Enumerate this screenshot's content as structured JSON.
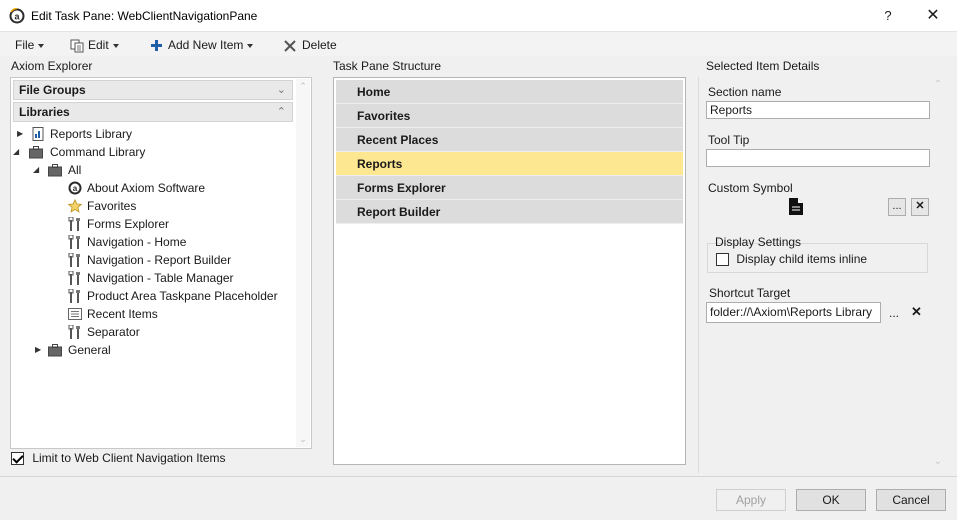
{
  "window": {
    "title": "Edit Task Pane: WebClientNavigationPane",
    "help_label": "?",
    "close_label": "✕"
  },
  "menu": {
    "file": "File",
    "edit": "Edit",
    "add_new_item": "Add New Item",
    "delete": "Delete"
  },
  "explorer": {
    "heading": "Axiom Explorer",
    "file_groups": "File Groups",
    "libraries": "Libraries",
    "tree": {
      "reports_library": "Reports Library",
      "command_library": "Command Library",
      "all": "All",
      "items": [
        {
          "label": "About Axiom Software",
          "icon": "axiom-logo-icon"
        },
        {
          "label": "Favorites",
          "icon": "star-icon"
        },
        {
          "label": "Forms Explorer",
          "icon": "tools-icon"
        },
        {
          "label": "Navigation - Home",
          "icon": "tools-icon"
        },
        {
          "label": "Navigation - Report Builder",
          "icon": "tools-icon"
        },
        {
          "label": "Navigation - Table Manager",
          "icon": "tools-icon"
        },
        {
          "label": "Product Area Taskpane Placeholder",
          "icon": "tools-icon"
        },
        {
          "label": "Recent Items",
          "icon": "recent-list-icon"
        },
        {
          "label": "Separator",
          "icon": "tools-icon"
        }
      ],
      "general": "General"
    },
    "limit_label": "Limit to Web Client Navigation Items",
    "limit_checked": true
  },
  "structure": {
    "heading": "Task Pane Structure",
    "items": [
      "Home",
      "Favorites",
      "Recent Places",
      "Reports",
      "Forms Explorer",
      "Report Builder"
    ],
    "selected": "Reports"
  },
  "details": {
    "heading": "Selected Item Details",
    "section_name_label": "Section name",
    "section_name_value": "Reports",
    "tooltip_label": "Tool Tip",
    "tooltip_value": "",
    "custom_symbol_label": "Custom Symbol",
    "ellipsis": "...",
    "clear": "✕",
    "display_settings_label": "Display Settings",
    "display_child_inline_label": "Display child items inline",
    "display_child_inline_checked": false,
    "shortcut_target_label": "Shortcut Target",
    "shortcut_target_value": "folder://\\Axiom\\Reports Library"
  },
  "footer": {
    "apply": "Apply",
    "ok": "OK",
    "cancel": "Cancel"
  },
  "colors": {
    "selected_row": "#fde791",
    "row_bg": "#dcdcdc",
    "accent": "#1f5fa8"
  }
}
